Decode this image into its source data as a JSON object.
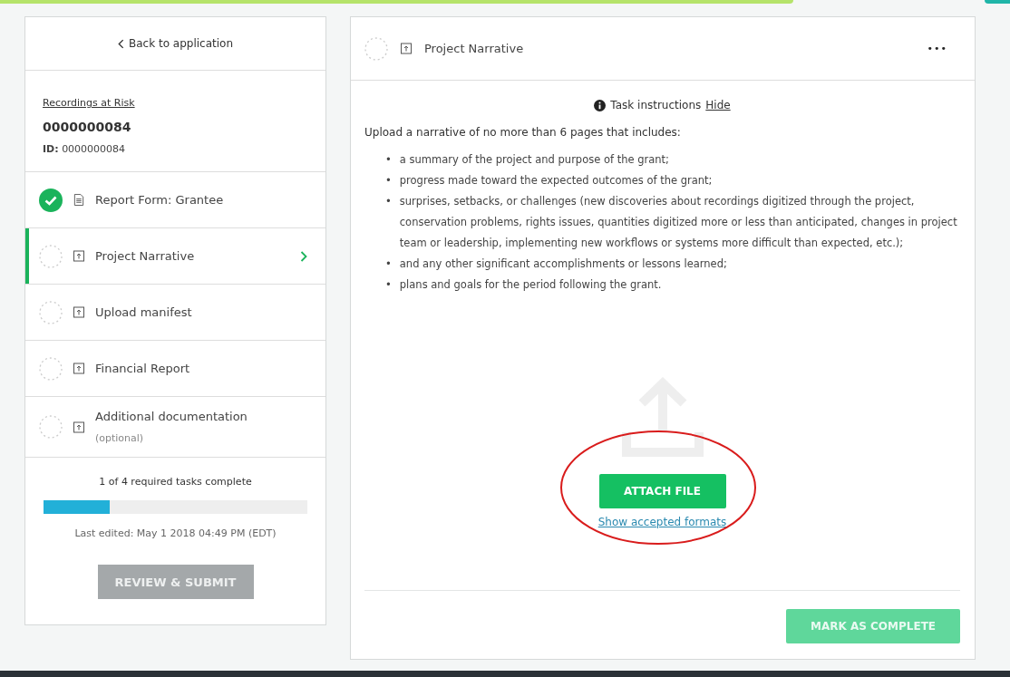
{
  "sidebar": {
    "back_link": "Back to application",
    "program_link": "Recordings at Risk",
    "record_number": "0000000084",
    "id_label": "ID:",
    "id_value": "0000000084",
    "tasks": [
      {
        "label": "Report Form: Grantee",
        "kind": "form",
        "complete": true,
        "selected": false
      },
      {
        "label": "Project Narrative",
        "kind": "upload",
        "complete": false,
        "selected": true
      },
      {
        "label": "Upload manifest",
        "kind": "upload",
        "complete": false,
        "selected": false
      },
      {
        "label": "Financial Report",
        "kind": "upload",
        "complete": false,
        "selected": false
      },
      {
        "label": "Additional documentation",
        "note": "(optional)",
        "kind": "upload",
        "complete": false,
        "selected": false
      }
    ],
    "progress_text": "1 of 4 required tasks complete",
    "progress": {
      "level": 0.25
    },
    "last_edited": "Last edited: May 1 2018 04:49 PM (EDT)",
    "submit_button": {
      "label": "REVIEW & SUBMIT",
      "disabled": true
    }
  },
  "task_panel": {
    "title": "Project Narrative",
    "complete": false,
    "kind": "upload",
    "menu": "•••",
    "instructions_label": "Task instructions",
    "hide_link": "Hide",
    "intro": "Upload a narrative of no more than 6 pages that includes:",
    "bullets": [
      {
        "marker": "•",
        "text": "a summary of the project and purpose of the grant;"
      },
      {
        "marker": "•",
        "text": "progress made toward the expected outcomes of the grant;"
      },
      {
        "marker": "•",
        "text": "surprises, setbacks, or challenges (new discoveries about recordings digitized through the project, conservation problems, rights issues, quantities digitized more or less than anticipated, changes in project team or leadership, implementing new workflows or systems more difficult than expected, etc.);"
      },
      {
        "marker": "•",
        "text": "and any other significant accomplishments or lessons learned;"
      },
      {
        "marker": "•",
        "text": "plans and goals for the period following the grant."
      }
    ],
    "attach_button": "ATTACH FILE",
    "formats_link": "Show accepted formats",
    "complete_button": {
      "label": "MARK AS COMPLETE",
      "disabled": true
    }
  }
}
